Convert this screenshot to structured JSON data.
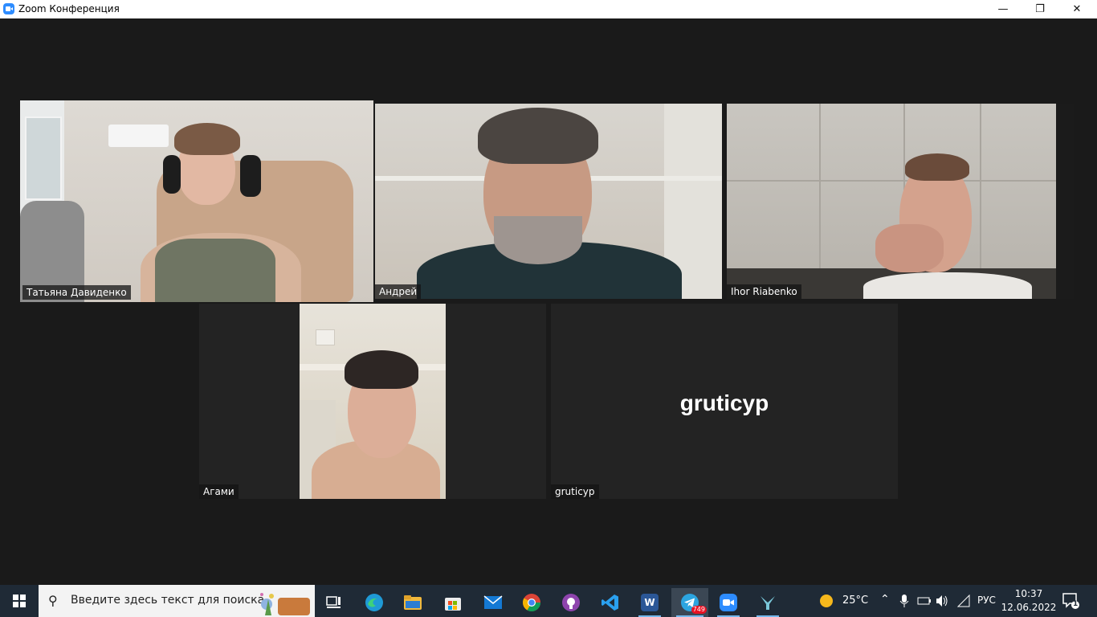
{
  "window": {
    "title": "Zoom Конференция",
    "controls": {
      "minimize": "—",
      "restore": "❐",
      "close": "✕"
    }
  },
  "participants": [
    {
      "name": "Татьяна Давиденко",
      "video": true,
      "active_speaker": true
    },
    {
      "name": "Андрей",
      "video": true,
      "active_speaker": false
    },
    {
      "name": "Ihor Riabenko",
      "video": true,
      "active_speaker": false
    },
    {
      "name": "Агами",
      "video": true,
      "active_speaker": false
    },
    {
      "name": "gruticyp",
      "video": false,
      "display_name": "gruticyp",
      "active_speaker": false
    }
  ],
  "taskbar": {
    "search_placeholder": "Введите здесь текст для поиска",
    "apps": [
      {
        "name": "task-view",
        "icon": "task-view-icon"
      },
      {
        "name": "edge",
        "icon": "edge-icon"
      },
      {
        "name": "file-explorer",
        "icon": "folder-icon"
      },
      {
        "name": "store",
        "icon": "store-icon"
      },
      {
        "name": "mail",
        "icon": "mail-icon"
      },
      {
        "name": "chrome",
        "icon": "chrome-icon"
      },
      {
        "name": "github-desktop",
        "icon": "github-icon"
      },
      {
        "name": "vscode",
        "icon": "vscode-icon"
      },
      {
        "name": "word",
        "icon": "word-icon",
        "label": "W"
      },
      {
        "name": "telegram",
        "icon": "telegram-icon",
        "badge": "749"
      },
      {
        "name": "zoom",
        "icon": "zoom-icon"
      },
      {
        "name": "app",
        "icon": "app-icon"
      }
    ],
    "tray": {
      "weather": "25°C",
      "language": "РУС",
      "time": "10:37",
      "date": "12.06.2022",
      "notifications": "1"
    }
  },
  "colors": {
    "active_speaker_border": "#d3ea7b",
    "stage_bg": "#1a1a1a",
    "taskbar_bg": "#1f2a36"
  }
}
